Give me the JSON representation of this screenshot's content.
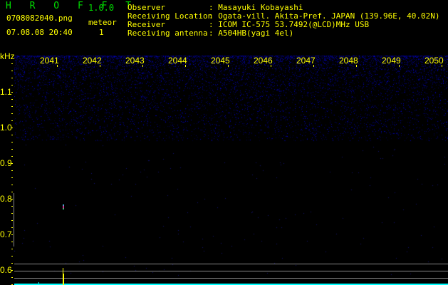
{
  "app": {
    "title": "H R O F F T",
    "version": "1.0.0"
  },
  "file": {
    "name": "0708082040.png",
    "datetime": "07.08.08 20:40"
  },
  "meteor": {
    "label": "meteor",
    "count": "1"
  },
  "info": [
    {
      "key": "Observer",
      "value": ": Masayuki Kobayashi"
    },
    {
      "key": "Receiving Location",
      "value": ": Ogata-vill. Akita-Pref. JAPAN (139.96E, 40.02N)"
    },
    {
      "key": "Receiver",
      "value": ": ICOM IC-575 53.7492(@LCD)MHz USB"
    },
    {
      "key": "Receiving antenna",
      "value": ": A504HB(yagi 4el)"
    }
  ],
  "axes": {
    "y_unit": "kHz",
    "y_labels": [
      "1.1",
      "1.0",
      "0.9",
      "0.8",
      "0.7",
      "0.6"
    ],
    "x_labels": [
      "2041",
      "2042",
      "2043",
      "2044",
      "2045",
      "2046",
      "2047",
      "2048",
      "2049",
      "2050"
    ]
  },
  "colors": {
    "text": "#ffff00",
    "title": "#00dd00",
    "noise": "#2020a0",
    "baseline": "#00ffff",
    "spike": "#ffff00"
  }
}
